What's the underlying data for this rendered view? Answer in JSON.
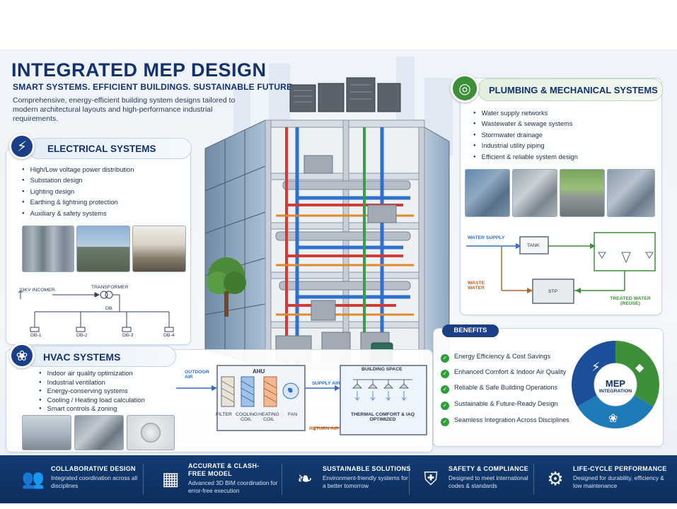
{
  "header": {
    "title": "INTEGRATED MEP DESIGN",
    "subtitle": "SMART SYSTEMS. EFFICIENT BUILDINGS. SUSTAINABLE FUTURE.",
    "intro": "Comprehensive, energy-efficient building system designs tailored to modern architectural layouts and high-performance industrial requirements."
  },
  "electrical": {
    "title": "ELECTRICAL SYSTEMS",
    "icon": "lightning-icon",
    "items": [
      "High/Low voltage power distribution",
      "Substation design",
      "Lighting design",
      "Earthing & lightning protection",
      "Auxiliary & safety systems"
    ],
    "diagram": {
      "incomer": "33KV INCOMER",
      "transformer": "TRANSFORMER",
      "db": "DB",
      "branches": [
        "DB-1",
        "DB-2",
        "DB-3",
        "DB-4"
      ]
    }
  },
  "plumbing": {
    "title": "PLUMBING & MECHANICAL SYSTEMS",
    "icon": "pipe-valve-icon",
    "items": [
      "Water supply networks",
      "Wastewater & sewage systems",
      "Stormwater drainage",
      "Industrial utility piping",
      "Efficient & reliable system design"
    ],
    "diagram": {
      "water_supply": "WATER SUPPLY",
      "tank": "TANK",
      "waste_water": "WASTE WATER",
      "stp": "STP",
      "treated_water": "TREATED WATER (REUSE)"
    }
  },
  "hvac": {
    "title": "HVAC SYSTEMS",
    "icon": "fan-icon",
    "items": [
      "Indoor air quality optimization",
      "Industrial ventilation",
      "Energy-conserving systems",
      "Cooling / Heating load calculation",
      "Smart controls & zoning"
    ],
    "diagram": {
      "outdoor_air": "OUTDOOR AIR",
      "ahu": "AHU",
      "components": [
        "FILTER",
        "COOLING COIL",
        "HEATING COIL",
        "FAN"
      ],
      "supply_air": "SUPPLY AIR",
      "return_air": "RETURN AIR",
      "building_space": "BUILDING SPACE",
      "comfort": "THERMAL COMFORT & IAQ OPTIMIZED"
    }
  },
  "benefits": {
    "title": "BENEFITS",
    "items": [
      "Energy Efficiency & Cost Savings",
      "Enhanced Comfort & Indoor Air Quality",
      "Reliable & Safe Building Operations",
      "Sustainable & Future-Ready Design",
      "Seamless Integration Across Disciplines"
    ],
    "wheel_title": "MEP",
    "wheel_subtitle": "INTEGRATION"
  },
  "footer": [
    {
      "title": "COLLABORATIVE DESIGN",
      "desc": "Integrated coordination across all disciplines",
      "icon": "team-icon"
    },
    {
      "title": "ACCURATE & CLASH-FREE MODEL",
      "desc": "Advanced 3D BIM coordination for error-free execution",
      "icon": "building-model-icon"
    },
    {
      "title": "SUSTAINABLE SOLUTIONS",
      "desc": "Environment-friendly systems for a better tomorrow",
      "icon": "leaf-icon"
    },
    {
      "title": "SAFETY & COMPLIANCE",
      "desc": "Designed to meet international codes & standards",
      "icon": "shield-check-icon"
    },
    {
      "title": "LIFE-CYCLE PERFORMANCE",
      "desc": "Designed for durability, efficiency & low maintenance",
      "icon": "gear-icon"
    }
  ],
  "colors": {
    "navy": "#13326d",
    "electrical": "#1b3f86",
    "plumbing": "#3d8f3a",
    "hvac": "#1b3f86",
    "check": "#2f9d3a",
    "supply_blue": "#2f6fd0",
    "waste_brown": "#b5652a",
    "treated_green": "#3d8f3a"
  }
}
